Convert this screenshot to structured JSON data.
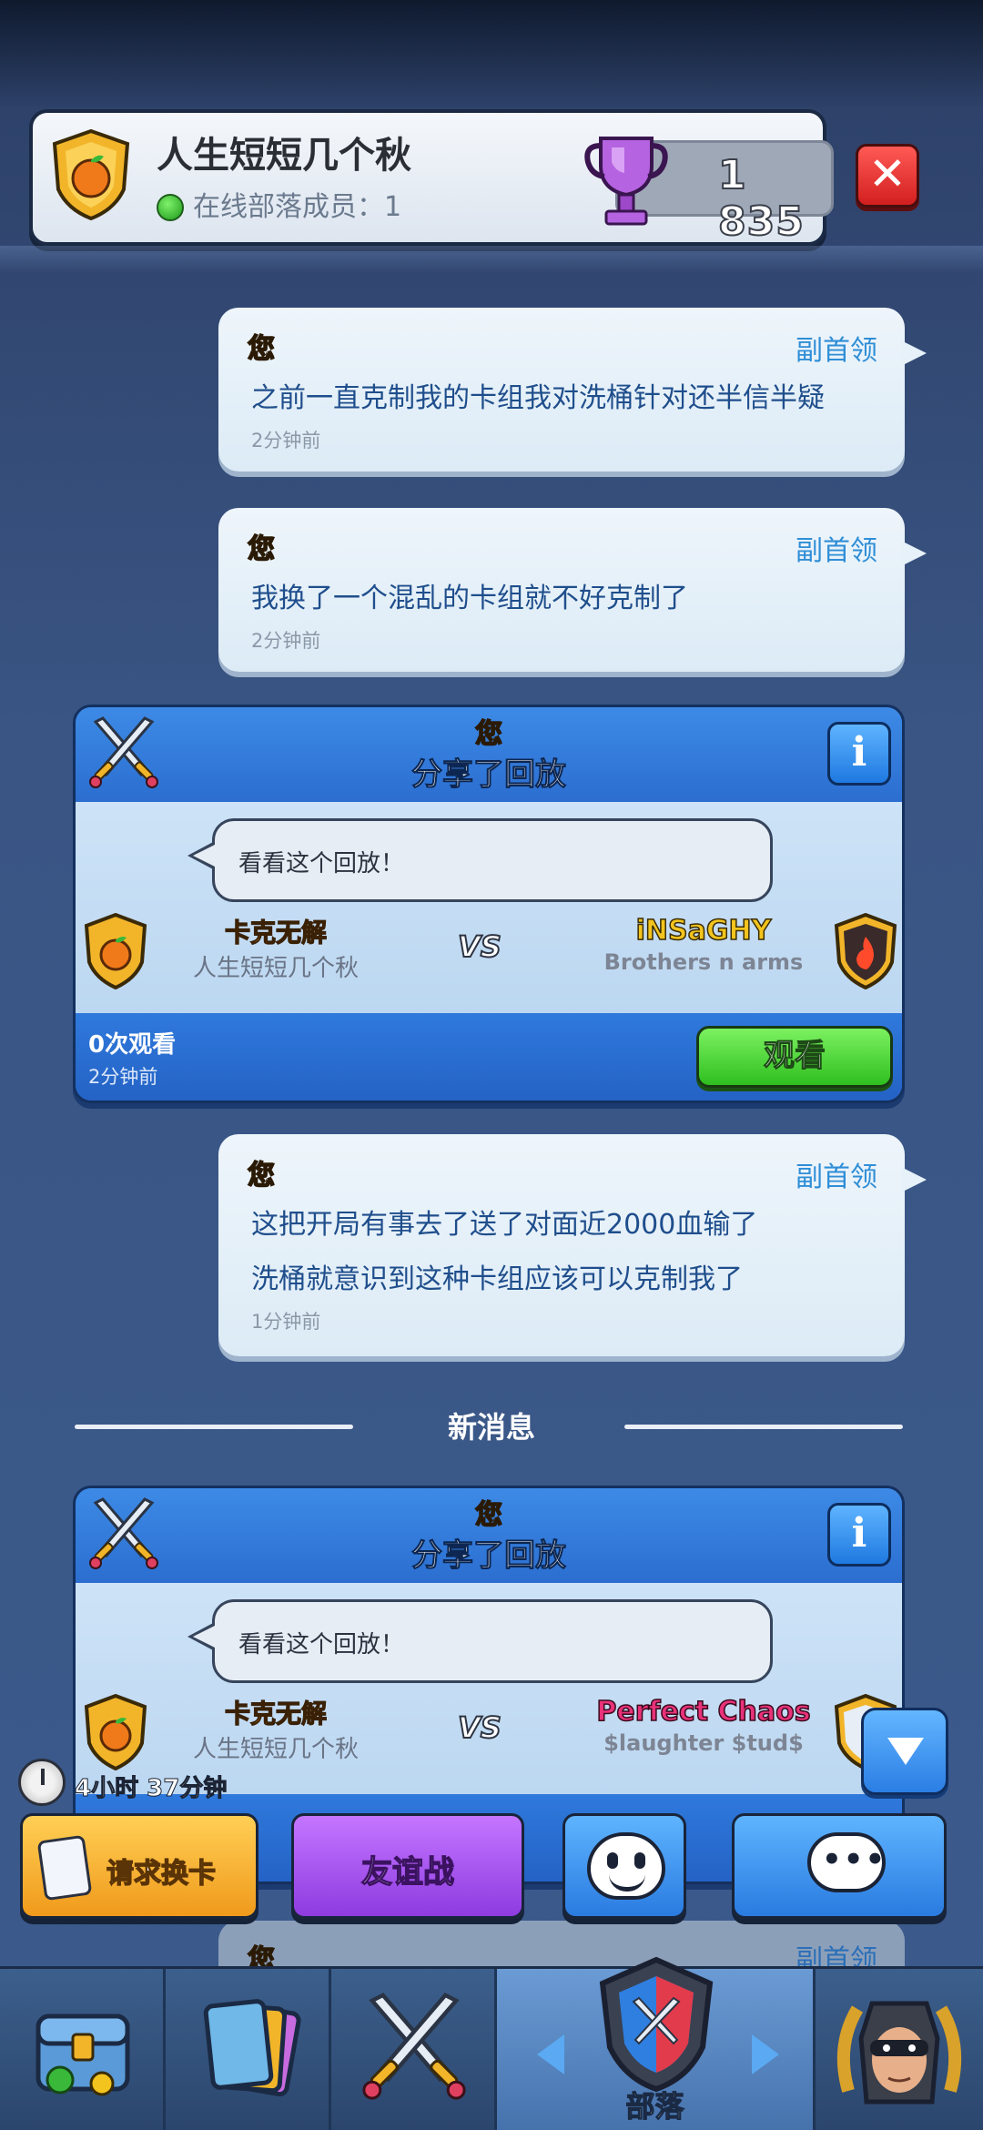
{
  "header": {
    "clan_name": "人生短短几个秋",
    "online_label": "在线部落成员：1",
    "trophies": "1 835"
  },
  "colors": {
    "sender_orange": "#f4a32a",
    "role_blue": "#2f8ed6",
    "watch_green": "#2fbf1f",
    "close_red": "#d21f1f"
  },
  "messages": [
    {
      "sender": "您",
      "role": "副首领",
      "lines": [
        "之前一直克制我的卡组我对洗桶针对还半信半疑"
      ],
      "time": "2分钟前"
    },
    {
      "sender": "您",
      "role": "副首领",
      "lines": [
        "我换了一个混乱的卡组就不好克制了"
      ],
      "time": "2分钟前"
    },
    {
      "sender": "您",
      "role": "副首领",
      "lines": [
        "这把开局有事去了送了对面近2000血输了",
        "洗桶就意识到这种卡组应该可以克制我了"
      ],
      "time": "1分钟前"
    }
  ],
  "replays": [
    {
      "sender": "您",
      "title": "分享了回放",
      "info": "i",
      "speech": "看看这个回放！",
      "p1_name": "卡克无解",
      "p1_clan": "人生短短几个秋",
      "vs": "VS",
      "p2_name": "iNSaGHY",
      "p2_clan": "Brothers n arms",
      "views": "0次观看",
      "time": "2分钟前",
      "watch": "观看"
    },
    {
      "sender": "您",
      "title": "分享了回放",
      "info": "i",
      "speech": "看看这个回放！",
      "p1_name": "卡克无解",
      "p1_clan": "人生短短几个秋",
      "vs": "VS",
      "p2_name": "Perfect Chaos",
      "p2_clan": "$laughter $tud$"
    }
  ],
  "divider": "新消息",
  "timer": "4小时 37分钟",
  "actions": {
    "request_cards": "请求换卡",
    "friendly_battle": "友谊战"
  },
  "partial": {
    "sender": "您",
    "role": "副首领"
  },
  "nav": {
    "active_label": "部落"
  }
}
